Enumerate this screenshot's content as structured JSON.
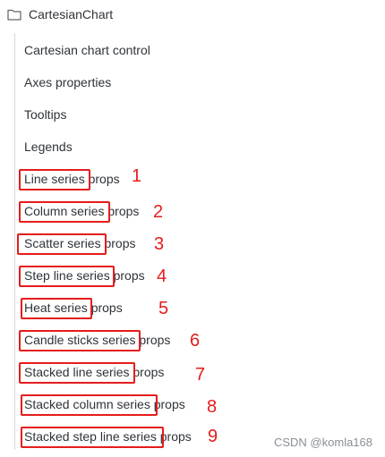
{
  "tree": {
    "folder_label": "CartesianChart",
    "items": [
      {
        "label": "Cartesian chart control"
      },
      {
        "label": "Axes properties"
      },
      {
        "label": "Tooltips"
      },
      {
        "label": "Legends"
      },
      {
        "label": "Line series props",
        "marker": "1"
      },
      {
        "label": "Column series props",
        "marker": "2"
      },
      {
        "label": "Scatter series props",
        "marker": "3"
      },
      {
        "label": "Step line series props",
        "marker": "4"
      },
      {
        "label": "Heat series props",
        "marker": "5"
      },
      {
        "label": "Candle sticks series props",
        "marker": "6"
      },
      {
        "label": "Stacked line series props",
        "marker": "7"
      },
      {
        "label": "Stacked column series props",
        "marker": "8"
      },
      {
        "label": "Stacked step line series props",
        "marker": "9"
      }
    ]
  },
  "watermark": "CSDN @komla168",
  "colors": {
    "annotation": "#e51c1c",
    "text": "#2f3338",
    "tree_line": "#d6d9dd"
  },
  "icons": {
    "folder": "folder-icon"
  }
}
